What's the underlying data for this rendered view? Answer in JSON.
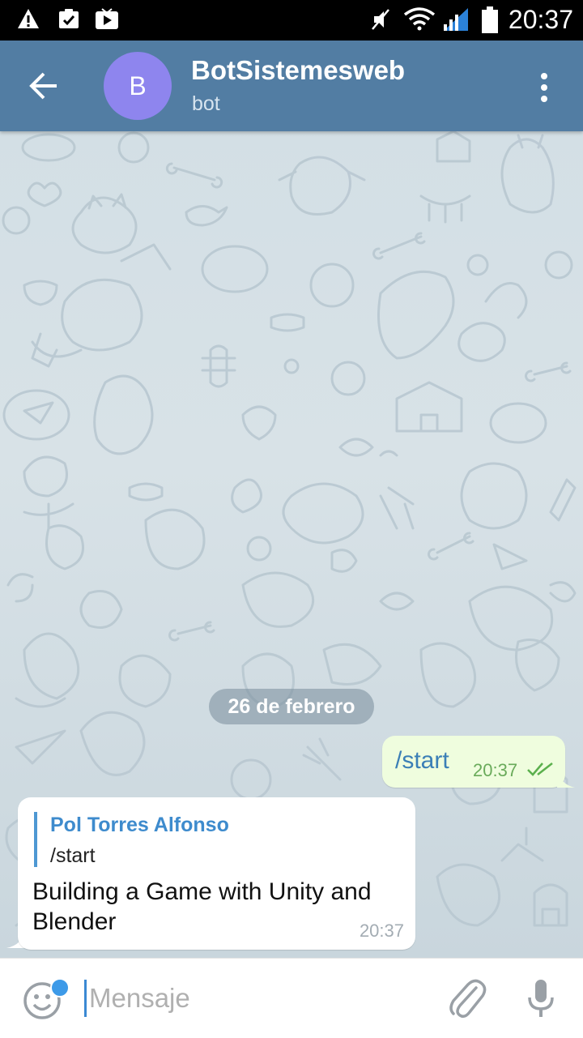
{
  "status_bar": {
    "time": "20:37",
    "icons": [
      "warning-icon",
      "clipboard-check-icon",
      "play-store-icon",
      "mute-icon",
      "wifi-icon",
      "signal-icon",
      "battery-icon"
    ]
  },
  "header": {
    "avatar_letter": "B",
    "title": "BotSistemesweb",
    "subtitle": "bot",
    "avatar_color": "#8e85ee",
    "bar_color": "#527da3"
  },
  "chat": {
    "date_separator": "26 de febrero",
    "outgoing": {
      "text": "/start",
      "time": "20:37",
      "status": "read"
    },
    "incoming": {
      "reply_to_name": "Pol Torres Alfonso",
      "reply_to_text": "/start",
      "text": "Building a Game with Unity and Blender",
      "time": "20:37"
    }
  },
  "input": {
    "placeholder": "Mensaje",
    "value": ""
  }
}
